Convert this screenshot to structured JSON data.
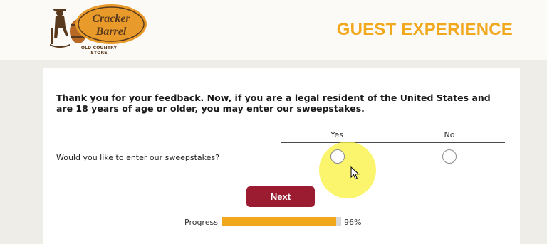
{
  "header": {
    "brand_name": "Cracker Barrel",
    "brand_tagline": "OLD COUNTRY STORE",
    "page_title": "GUEST EXPERIENCE"
  },
  "survey": {
    "intro_text": "Thank you for your feedback. Now, if you are a legal resident of the United States and are 18 years of age or older, you may enter our sweepstakes.",
    "columns": [
      "Yes",
      "No"
    ],
    "question": "Would you like to enter our sweepstakes?",
    "next_label": "Next"
  },
  "progress": {
    "label": "Progress",
    "value": 0.96,
    "text": "96%"
  },
  "colors": {
    "accent": "#f2a81d",
    "button": "#9b1b31",
    "logo_brown": "#5a3a1e",
    "logo_orange": "#e89a2a"
  }
}
